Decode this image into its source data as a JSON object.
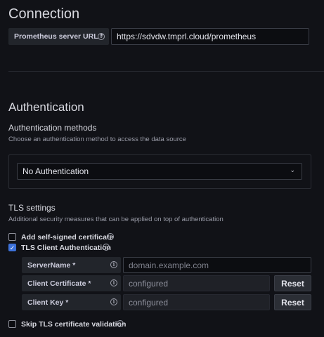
{
  "connection": {
    "title": "Connection",
    "url_label": "Prometheus server URL *",
    "url_value": "https://sdvdw.tmprl.cloud/prometheus"
  },
  "auth": {
    "title": "Authentication",
    "methods_title": "Authentication methods",
    "methods_desc": "Choose an authentication method to access the data source",
    "method_selected": "No Authentication"
  },
  "tls": {
    "title": "TLS settings",
    "desc": "Additional security measures that can be applied on top of authentication",
    "self_signed_label": "Add self-signed certificate",
    "client_auth_label": "TLS Client Authentication",
    "server_name_label": "ServerName *",
    "server_name_placeholder": "domain.example.com",
    "client_cert_label": "Client Certificate *",
    "client_cert_value": "configured",
    "client_key_label": "Client Key *",
    "client_key_value": "configured",
    "reset_label": "Reset",
    "skip_label": "Skip TLS certificate validation"
  },
  "colors": {
    "background": "#111217",
    "accent": "#3d71d9"
  }
}
